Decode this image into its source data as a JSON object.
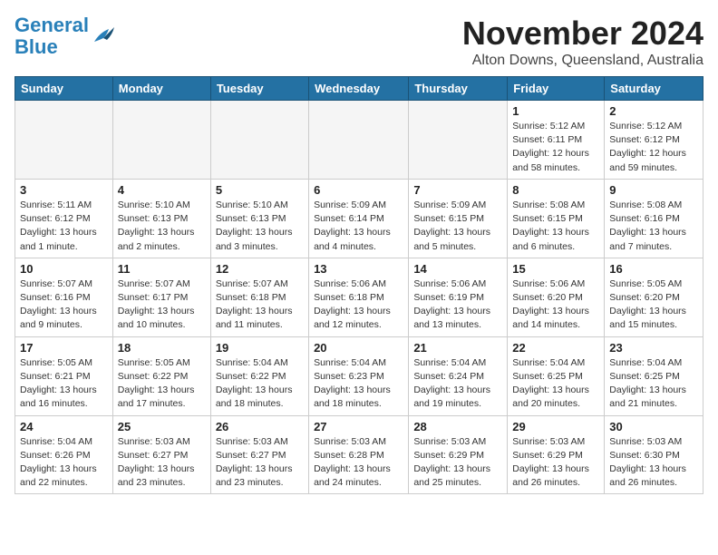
{
  "logo": {
    "line1": "General",
    "line2": "Blue"
  },
  "title": "November 2024",
  "location": "Alton Downs, Queensland, Australia",
  "weekdays": [
    "Sunday",
    "Monday",
    "Tuesday",
    "Wednesday",
    "Thursday",
    "Friday",
    "Saturday"
  ],
  "weeks": [
    [
      {
        "day": "",
        "info": ""
      },
      {
        "day": "",
        "info": ""
      },
      {
        "day": "",
        "info": ""
      },
      {
        "day": "",
        "info": ""
      },
      {
        "day": "",
        "info": ""
      },
      {
        "day": "1",
        "info": "Sunrise: 5:12 AM\nSunset: 6:11 PM\nDaylight: 12 hours\nand 58 minutes."
      },
      {
        "day": "2",
        "info": "Sunrise: 5:12 AM\nSunset: 6:12 PM\nDaylight: 12 hours\nand 59 minutes."
      }
    ],
    [
      {
        "day": "3",
        "info": "Sunrise: 5:11 AM\nSunset: 6:12 PM\nDaylight: 13 hours\nand 1 minute."
      },
      {
        "day": "4",
        "info": "Sunrise: 5:10 AM\nSunset: 6:13 PM\nDaylight: 13 hours\nand 2 minutes."
      },
      {
        "day": "5",
        "info": "Sunrise: 5:10 AM\nSunset: 6:13 PM\nDaylight: 13 hours\nand 3 minutes."
      },
      {
        "day": "6",
        "info": "Sunrise: 5:09 AM\nSunset: 6:14 PM\nDaylight: 13 hours\nand 4 minutes."
      },
      {
        "day": "7",
        "info": "Sunrise: 5:09 AM\nSunset: 6:15 PM\nDaylight: 13 hours\nand 5 minutes."
      },
      {
        "day": "8",
        "info": "Sunrise: 5:08 AM\nSunset: 6:15 PM\nDaylight: 13 hours\nand 6 minutes."
      },
      {
        "day": "9",
        "info": "Sunrise: 5:08 AM\nSunset: 6:16 PM\nDaylight: 13 hours\nand 7 minutes."
      }
    ],
    [
      {
        "day": "10",
        "info": "Sunrise: 5:07 AM\nSunset: 6:16 PM\nDaylight: 13 hours\nand 9 minutes."
      },
      {
        "day": "11",
        "info": "Sunrise: 5:07 AM\nSunset: 6:17 PM\nDaylight: 13 hours\nand 10 minutes."
      },
      {
        "day": "12",
        "info": "Sunrise: 5:07 AM\nSunset: 6:18 PM\nDaylight: 13 hours\nand 11 minutes."
      },
      {
        "day": "13",
        "info": "Sunrise: 5:06 AM\nSunset: 6:18 PM\nDaylight: 13 hours\nand 12 minutes."
      },
      {
        "day": "14",
        "info": "Sunrise: 5:06 AM\nSunset: 6:19 PM\nDaylight: 13 hours\nand 13 minutes."
      },
      {
        "day": "15",
        "info": "Sunrise: 5:06 AM\nSunset: 6:20 PM\nDaylight: 13 hours\nand 14 minutes."
      },
      {
        "day": "16",
        "info": "Sunrise: 5:05 AM\nSunset: 6:20 PM\nDaylight: 13 hours\nand 15 minutes."
      }
    ],
    [
      {
        "day": "17",
        "info": "Sunrise: 5:05 AM\nSunset: 6:21 PM\nDaylight: 13 hours\nand 16 minutes."
      },
      {
        "day": "18",
        "info": "Sunrise: 5:05 AM\nSunset: 6:22 PM\nDaylight: 13 hours\nand 17 minutes."
      },
      {
        "day": "19",
        "info": "Sunrise: 5:04 AM\nSunset: 6:22 PM\nDaylight: 13 hours\nand 18 minutes."
      },
      {
        "day": "20",
        "info": "Sunrise: 5:04 AM\nSunset: 6:23 PM\nDaylight: 13 hours\nand 18 minutes."
      },
      {
        "day": "21",
        "info": "Sunrise: 5:04 AM\nSunset: 6:24 PM\nDaylight: 13 hours\nand 19 minutes."
      },
      {
        "day": "22",
        "info": "Sunrise: 5:04 AM\nSunset: 6:25 PM\nDaylight: 13 hours\nand 20 minutes."
      },
      {
        "day": "23",
        "info": "Sunrise: 5:04 AM\nSunset: 6:25 PM\nDaylight: 13 hours\nand 21 minutes."
      }
    ],
    [
      {
        "day": "24",
        "info": "Sunrise: 5:04 AM\nSunset: 6:26 PM\nDaylight: 13 hours\nand 22 minutes."
      },
      {
        "day": "25",
        "info": "Sunrise: 5:03 AM\nSunset: 6:27 PM\nDaylight: 13 hours\nand 23 minutes."
      },
      {
        "day": "26",
        "info": "Sunrise: 5:03 AM\nSunset: 6:27 PM\nDaylight: 13 hours\nand 23 minutes."
      },
      {
        "day": "27",
        "info": "Sunrise: 5:03 AM\nSunset: 6:28 PM\nDaylight: 13 hours\nand 24 minutes."
      },
      {
        "day": "28",
        "info": "Sunrise: 5:03 AM\nSunset: 6:29 PM\nDaylight: 13 hours\nand 25 minutes."
      },
      {
        "day": "29",
        "info": "Sunrise: 5:03 AM\nSunset: 6:29 PM\nDaylight: 13 hours\nand 26 minutes."
      },
      {
        "day": "30",
        "info": "Sunrise: 5:03 AM\nSunset: 6:30 PM\nDaylight: 13 hours\nand 26 minutes."
      }
    ]
  ]
}
